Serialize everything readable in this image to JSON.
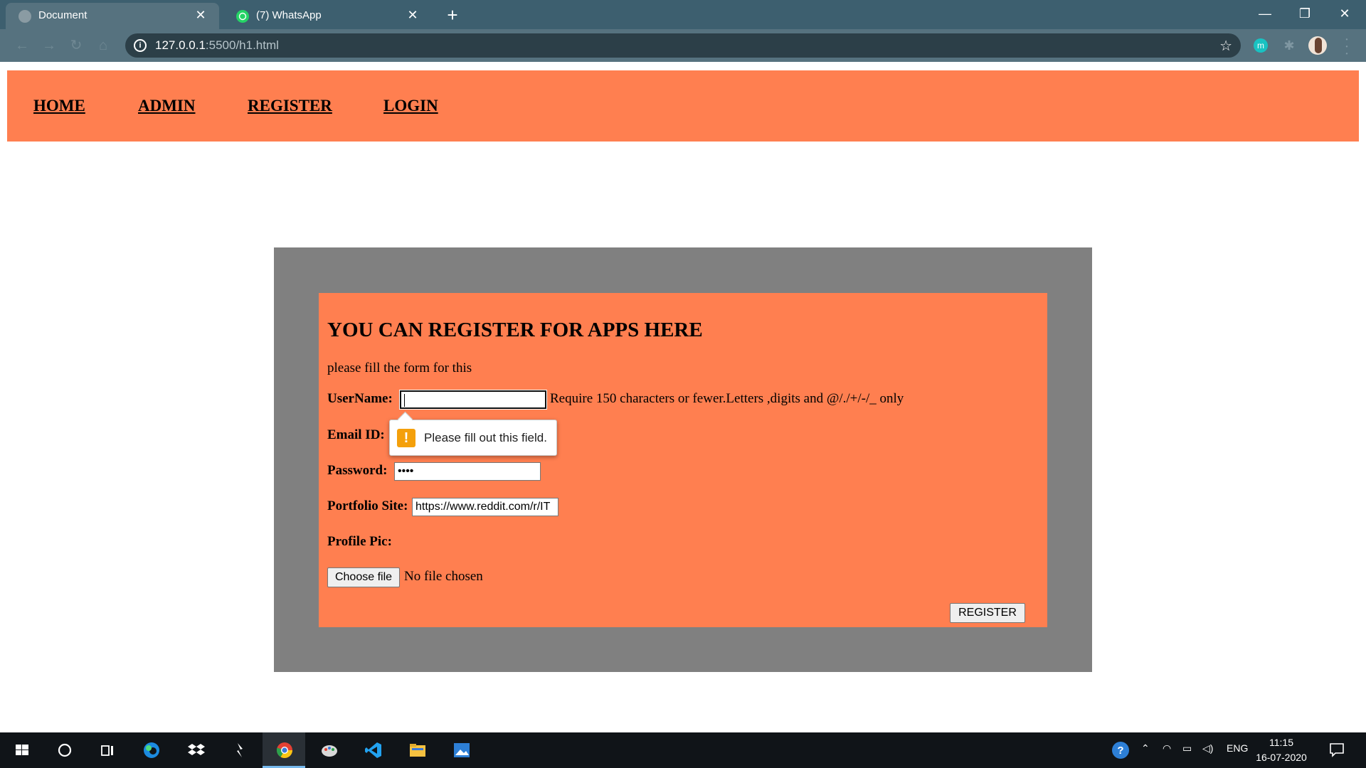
{
  "browser": {
    "tabs": [
      {
        "title": "Document",
        "active": true
      },
      {
        "title": "(7) WhatsApp",
        "active": false
      }
    ],
    "address": {
      "host": "127.0.0.1",
      "path": ":5500/h1.html"
    },
    "icons": {
      "info": "info-icon",
      "bookmark": "star-icon",
      "extension": "m-extension-icon"
    },
    "extension_letter": "m"
  },
  "nav": {
    "items": [
      {
        "label": "HOME"
      },
      {
        "label": "ADMIN"
      },
      {
        "label": "REGISTER"
      },
      {
        "label": "LOGIN"
      }
    ]
  },
  "form": {
    "title": "YOU CAN REGISTER FOR APPS HERE",
    "subtitle": "please fill the form for this",
    "username": {
      "label": "UserName:",
      "value": "",
      "hint": "Require 150 characters or fewer.Letters ,digits and @/./+/-/_ only"
    },
    "email": {
      "label": "Email ID:",
      "value": ""
    },
    "password": {
      "label": "Password:",
      "value": "••••"
    },
    "portfolio": {
      "label": "Portfolio Site:",
      "value": "https://www.reddit.com/r/IT"
    },
    "profile_pic": {
      "label": "Profile Pic:",
      "button": "Choose file",
      "status": "No file chosen"
    },
    "submit": "REGISTER",
    "validation_message": "Please fill out this field."
  },
  "taskbar": {
    "tray_language": "ENG",
    "time": "11:15",
    "date": "16-07-2020"
  },
  "colors": {
    "accent": "#ff7f50",
    "panel": "#808080",
    "chrome_tabbar": "#3d5f6f",
    "chrome_toolbar": "#56727f",
    "taskbar": "#101418"
  }
}
